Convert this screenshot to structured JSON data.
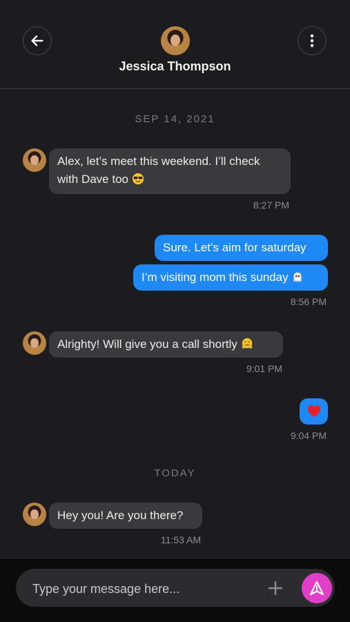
{
  "header": {
    "contact_name": "Jessica Thompson",
    "back_icon": "arrow-left-icon",
    "more_icon": "more-vertical-icon"
  },
  "conversation": {
    "date_labels": [
      "SEP 14, 2021",
      "TODAY"
    ],
    "messages": [
      {
        "direction": "in",
        "line1": "Alex, let’s meet this weekend. I’ll check",
        "line2": "with Dave too",
        "emoji": "sunglasses-emoji",
        "time": "8:27 PM"
      },
      {
        "direction": "out",
        "text": "Sure. Let’s aim for saturday"
      },
      {
        "direction": "out",
        "text": "I’m visiting mom this sunday",
        "emoji": "ghost-emoji",
        "time": "8:56 PM"
      },
      {
        "direction": "in",
        "text": "Alrighty! Will give you a call shortly",
        "emoji": "hugging-face-emoji",
        "time": "9:01 PM"
      },
      {
        "direction": "out",
        "emoji": "red-heart-emoji",
        "time": "9:04 PM"
      },
      {
        "direction": "in",
        "text": "Hey you! Are you there?",
        "time": "11:53 AM"
      }
    ]
  },
  "composer": {
    "placeholder": "Type your message here...",
    "add_icon": "plus-icon",
    "send_icon": "send-icon",
    "send_color": "#e040c8"
  },
  "colors": {
    "background": "#1c1c1e",
    "incoming_bubble": "#3a3a3c",
    "outgoing_bubble": "#1e88f5"
  }
}
